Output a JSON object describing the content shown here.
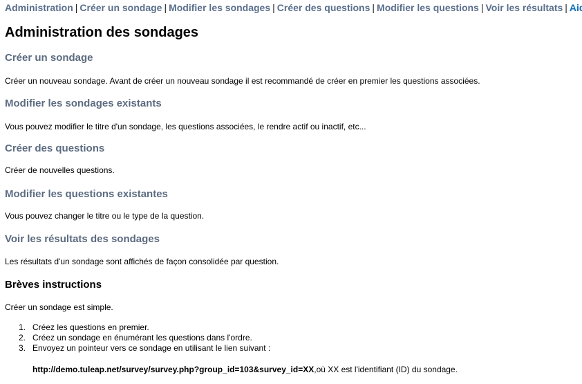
{
  "nav": {
    "items": [
      {
        "label": "Administration"
      },
      {
        "label": "Créer un sondage"
      },
      {
        "label": "Modifier les sondages"
      },
      {
        "label": "Créer des questions"
      },
      {
        "label": "Modifier les questions"
      },
      {
        "label": "Voir les résultats"
      },
      {
        "label": "Aide"
      }
    ],
    "separator": "|"
  },
  "page_title": "Administration des sondages",
  "sections": [
    {
      "heading": "Créer un sondage",
      "text": "Créer un nouveau sondage. Avant de créer un nouveau sondage il est recommandé de créer en premier les questions associées."
    },
    {
      "heading": "Modifier les sondages existants",
      "text": "Vous pouvez modifier le titre d'un sondage, les questions associées, le rendre actif ou inactif, etc..."
    },
    {
      "heading": "Créer des questions",
      "text": "Créer de nouvelles questions."
    },
    {
      "heading": "Modifier les questions existantes",
      "text": "Vous pouvez changer le titre ou le type de la question."
    },
    {
      "heading": "Voir les résultats des sondages",
      "text": "Les résultats d'un sondage sont affichés de façon consolidée par question."
    }
  ],
  "instructions": {
    "heading": "Brèves instructions",
    "intro": "Créer un sondage est simple.",
    "steps": [
      {
        "num": "1.",
        "text": "Créez les questions en premier."
      },
      {
        "num": "2.",
        "text": "Créez un sondage en énumérant les questions dans l'ordre."
      },
      {
        "num": "3.",
        "text": "Envoyez un pointeur vers ce sondage en utilisant le lien suivant :"
      }
    ],
    "url": "http://demo.tuleap.net/survey/survey.php?group_id=103&survey_id=XX",
    "url_suffix": ",où XX est l'identifiant (ID) du sondage."
  },
  "colors": {
    "nav_link": "#5a6f8c",
    "nav_active": "#0b6fb8",
    "section_heading": "#5c6b80"
  }
}
